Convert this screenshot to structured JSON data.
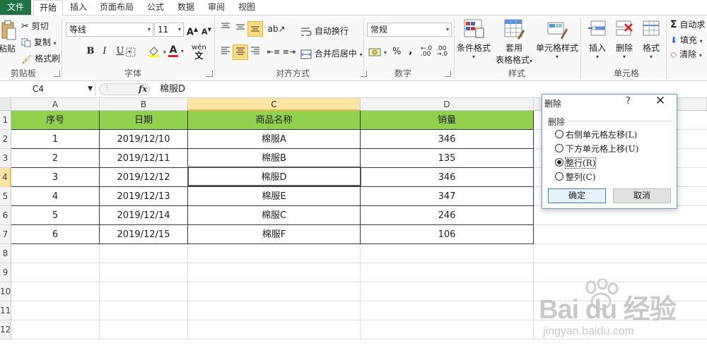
{
  "tabs": [
    "文件",
    "开始",
    "插入",
    "页面布局",
    "公式",
    "数据",
    "审阅",
    "视图"
  ],
  "active_tab": "开始",
  "clipboard": {
    "paste": "粘贴",
    "cut": "剪切",
    "copy": "复制",
    "painter": "格式刷",
    "group": "剪贴板"
  },
  "font": {
    "name": "等线",
    "size": "11",
    "grow": "A",
    "shrink": "A",
    "bold": "B",
    "italic": "I",
    "underline": "U",
    "phonetic": "wén",
    "color_mark": "A",
    "group": "字体"
  },
  "alignment": {
    "wrap": "自动换行",
    "merge": "合并后居中",
    "group": "对齐方式"
  },
  "number": {
    "format": "常规",
    "percent": "%",
    "comma": ",",
    "group": "数字"
  },
  "styles": {
    "conditional": "条件格式",
    "table_line1": "套用",
    "table_line2": "表格格式",
    "cell_style": "单元格样式",
    "group": "样式"
  },
  "cells": {
    "insert": "插入",
    "delete": "删除",
    "format": "格式",
    "group": "单元格"
  },
  "editing": {
    "autosum_symbol": "Σ",
    "autosum": "自动求",
    "fill": "填充",
    "clear": "清除"
  },
  "formula_bar": {
    "name_box": "C4",
    "fx": "fx",
    "value": "棉服D"
  },
  "sheet": {
    "columns": [
      "A",
      "B",
      "C",
      "D"
    ],
    "row_numbers": [
      "1",
      "2",
      "3",
      "4",
      "5",
      "6",
      "7",
      "8",
      "9",
      "10",
      "11",
      "12"
    ],
    "headers": [
      "序号",
      "日期",
      "商品名称",
      "销量"
    ],
    "header_fill": "#92d050",
    "rows": [
      [
        "1",
        "2019/12/10",
        "棉服A",
        "346"
      ],
      [
        "2",
        "2019/12/11",
        "棉服B",
        "135"
      ],
      [
        "3",
        "2019/12/12",
        "棉服D",
        "346"
      ],
      [
        "4",
        "2019/12/13",
        "棉服E",
        "347"
      ],
      [
        "5",
        "2019/12/14",
        "棉服C",
        "246"
      ],
      [
        "6",
        "2019/12/15",
        "棉服F",
        "106"
      ]
    ]
  },
  "dialog": {
    "title": "删除",
    "help": "?",
    "close": "✕",
    "section": "删除",
    "options": [
      "右侧单元格左移(L)",
      "下方单元格上移(U)",
      "整行(R)",
      "整列(C)"
    ],
    "selected": "整行(R)",
    "ok": "确定",
    "cancel": "取消"
  },
  "watermark": {
    "brand": "Bai du 经验",
    "sub": "jingyan.baidu.com"
  }
}
